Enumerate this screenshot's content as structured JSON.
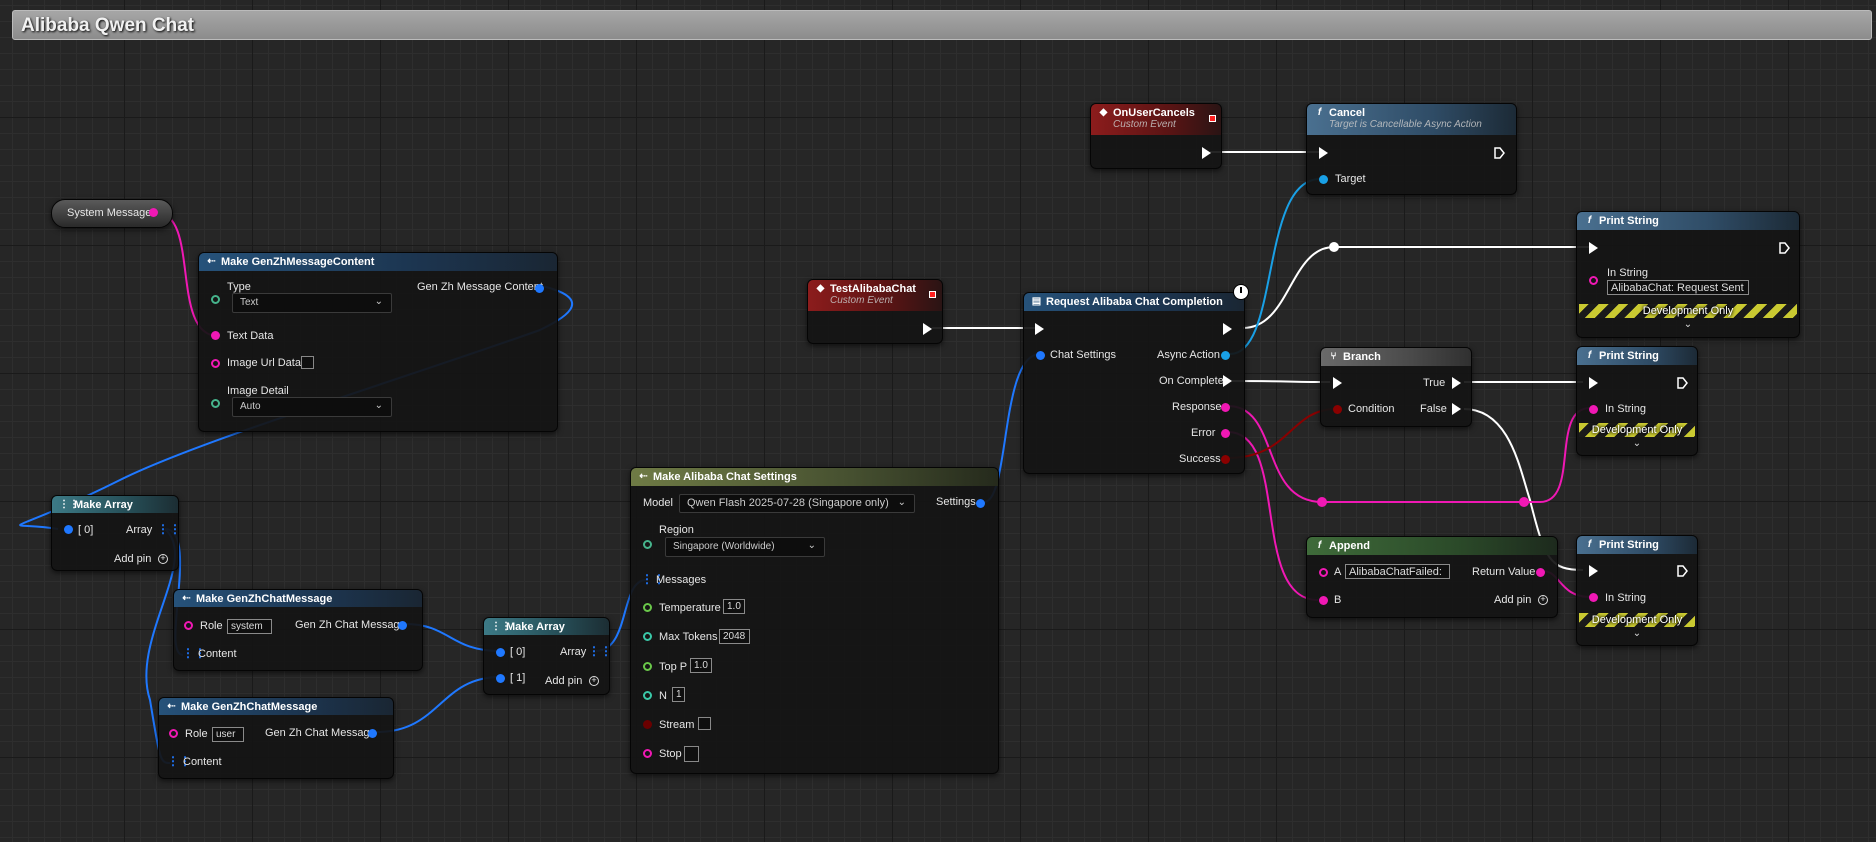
{
  "graph": {
    "title": "Alibaba Qwen Chat"
  },
  "colors": {
    "exec": "#ffffff",
    "string": "#f018b4",
    "struct": "#1f78ff",
    "object": "#19a0e6",
    "bool": "#8a0000",
    "float": "#6ac84a",
    "int": "#3ac8a8"
  },
  "nodes": {
    "system_message": {
      "label": "System Message"
    },
    "make_content": {
      "title": "Make GenZhMessageContent",
      "type_label": "Type",
      "type_value": "Text",
      "text_data": "Text Data",
      "image_url_data": "Image Url Data",
      "image_detail_label": "Image Detail",
      "image_detail_value": "Auto",
      "output": "Gen Zh Message Content"
    },
    "make_array1": {
      "title": "Make Array",
      "in0": "[ 0]",
      "out": "Array",
      "add_pin": "Add pin"
    },
    "make_msg1": {
      "title": "Make GenZhChatMessage",
      "role_label": "Role",
      "role_value": "system",
      "content": "Content",
      "output": "Gen Zh Chat Message"
    },
    "make_msg2": {
      "title": "Make GenZhChatMessage",
      "role_label": "Role",
      "role_value": "user",
      "content": "Content",
      "output": "Gen Zh Chat Message"
    },
    "make_array2": {
      "title": "Make Array",
      "in0": "[ 0]",
      "in1": "[ 1]",
      "out": "Array",
      "add_pin": "Add pin"
    },
    "settings": {
      "title": "Make Alibaba Chat Settings",
      "model_label": "Model",
      "model_value": "Qwen Flash 2025-07-28 (Singapore only)",
      "output": "Settings",
      "region_label": "Region",
      "region_value": "Singapore (Worldwide)",
      "messages": "Messages",
      "temperature_label": "Temperature",
      "temperature_value": "1.0",
      "max_tokens_label": "Max Tokens",
      "max_tokens_value": "2048",
      "top_p_label": "Top P",
      "top_p_value": "1.0",
      "n_label": "N",
      "n_value": "1",
      "stream_label": "Stream",
      "stop_label": "Stop"
    },
    "test_event": {
      "title": "TestAlibabaChat",
      "subtitle": "Custom Event"
    },
    "request": {
      "title": "Request Alibaba Chat Completion",
      "chat_settings": "Chat Settings",
      "async_action": "Async Action",
      "on_complete": "On Complete",
      "response": "Response",
      "error": "Error",
      "success": "Success"
    },
    "cancels_event": {
      "title": "OnUserCancels",
      "subtitle": "Custom Event"
    },
    "cancel": {
      "title": "Cancel",
      "subtitle": "Target is Cancellable Async Action",
      "target": "Target"
    },
    "print1": {
      "title": "Print String",
      "in_string": "In String",
      "value": "AlibabaChat: Request Sent",
      "dev_only": "Development Only"
    },
    "branch": {
      "title": "Branch",
      "condition": "Condition",
      "true_label": "True",
      "false_label": "False"
    },
    "print2": {
      "title": "Print String",
      "in_string": "In String",
      "dev_only": "Development Only"
    },
    "append": {
      "title": "Append",
      "a_label": "A",
      "a_value": "AlibabaChatFailed:",
      "b_label": "B",
      "return_value": "Return Value",
      "add_pin": "Add pin"
    },
    "print3": {
      "title": "Print String",
      "in_string": "In String",
      "dev_only": "Development Only"
    }
  }
}
